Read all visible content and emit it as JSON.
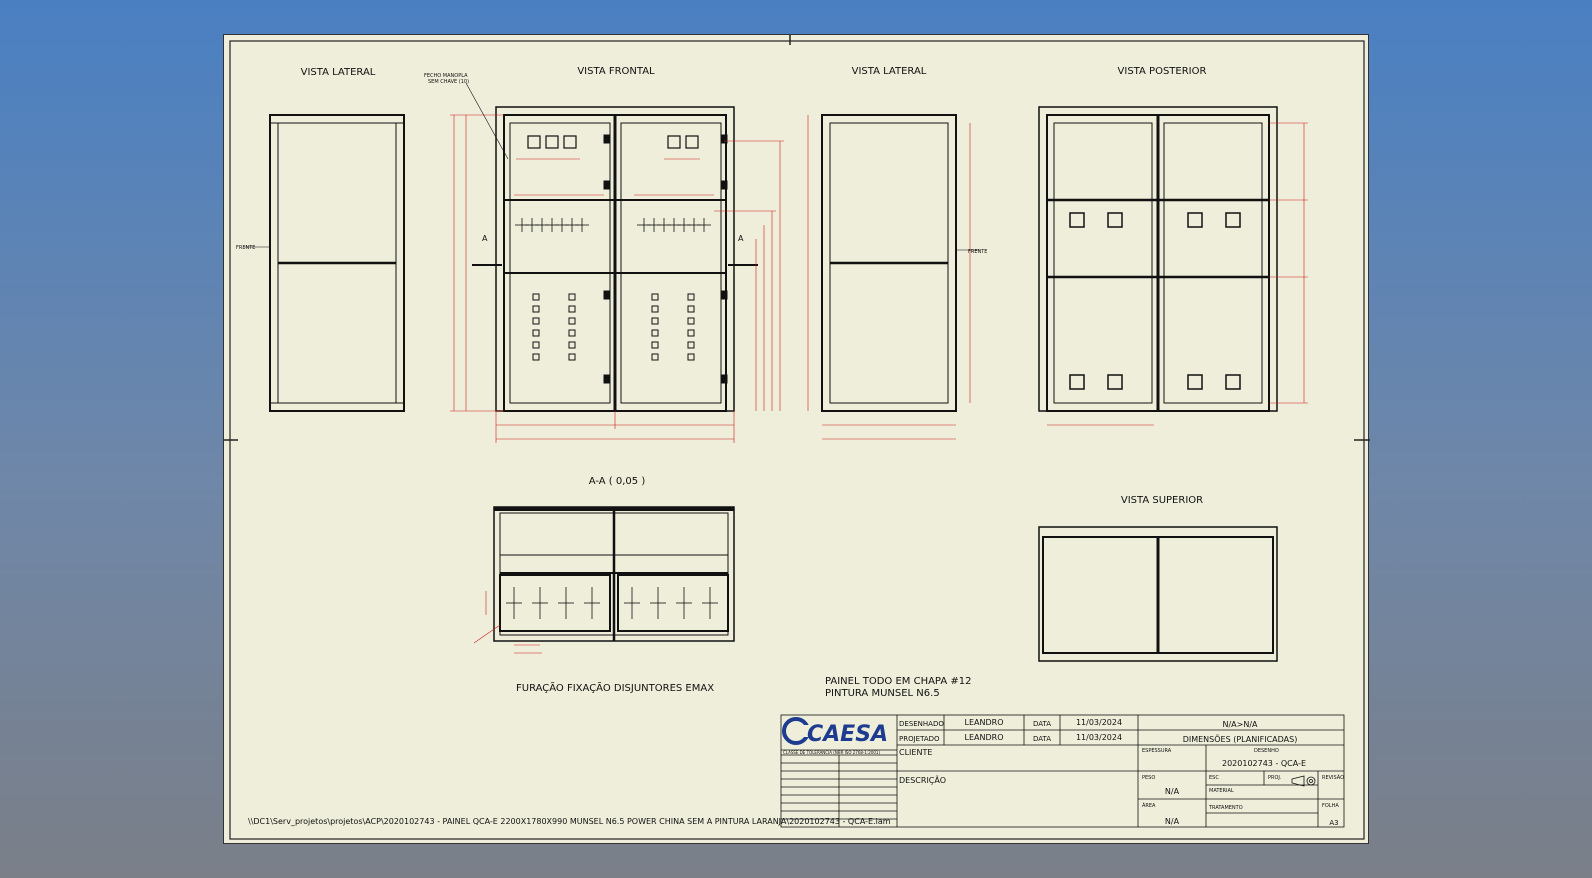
{
  "views": {
    "vista_lateral_esq": "VISTA LATERAL",
    "vista_frontal": "VISTA FRONTAL",
    "vista_lateral_dir": "VISTA LATERAL",
    "vista_posterior": "VISTA POSTERIOR",
    "section_aa": "A-A ( 0,05 )",
    "vista_superior": "VISTA SUPERIOR"
  },
  "labels": {
    "furacao": "FURAÇÃO FIXAÇÃO DISJUNTORES EMAX",
    "painel_note_1": "PAINEL TODO EM CHAPA #12",
    "painel_note_2": "PINTURA MUNSEL N6.5",
    "frente_left": "FRENTE",
    "frente_right": "FRENTE",
    "fecho_1": "FECHO MANOPLA",
    "fecho_2": "SEM CHAVE (10)",
    "section_mark": "A"
  },
  "title_block": {
    "brand": "CAESA",
    "desenhado_label": "DESENHADO",
    "desenhado_value": "LEANDRO",
    "projetado_label": "PROJETADO",
    "projetado_value": "LEANDRO",
    "data_label": "DATA",
    "data_1": "11/03/2024",
    "data_2": "11/03/2024",
    "scale": "N/A>N/A",
    "dimensoes": "DIMENSÕES (PLANIFICADAS)",
    "cliente_label": "CLIENTE",
    "descricao_label": "DESCRIÇÃO",
    "espessura_label": "ESPESSURA",
    "desenho_label": "DESENHO",
    "desenho_value": "2020102743 - QCA-E",
    "peso_label": "PESO",
    "peso_value": "N/A",
    "area_label": "ÁREA",
    "area_value": "N/A",
    "esc_label": "ESC",
    "proj_label": "PROJ.",
    "revisao_label": "REVISÃO",
    "material_label": "MATERIAL",
    "tratamento_label": "TRATAMENTO",
    "folha_label": "FOLHA",
    "folha_value": "A3",
    "tolerance_header": "CLASSE DE TOLERÂNCIA (NBR ISO 2768-1:2001)"
  },
  "file_path": "\\\\DC1\\Serv_projetos\\projetos\\ACP\\2020102743 - PAINEL QCA-E 2200X1780X990 MUNSEL N6.5 POWER CHINA SEM A PINTURA LARANJA\\2020102743 - QCA-E.iam",
  "colors": {
    "background_top": "#4a80c2",
    "sheet": "#eeeedb",
    "line": "#111111",
    "dimension": "#d21a1a",
    "brand_blue": "#1d3b8f"
  }
}
